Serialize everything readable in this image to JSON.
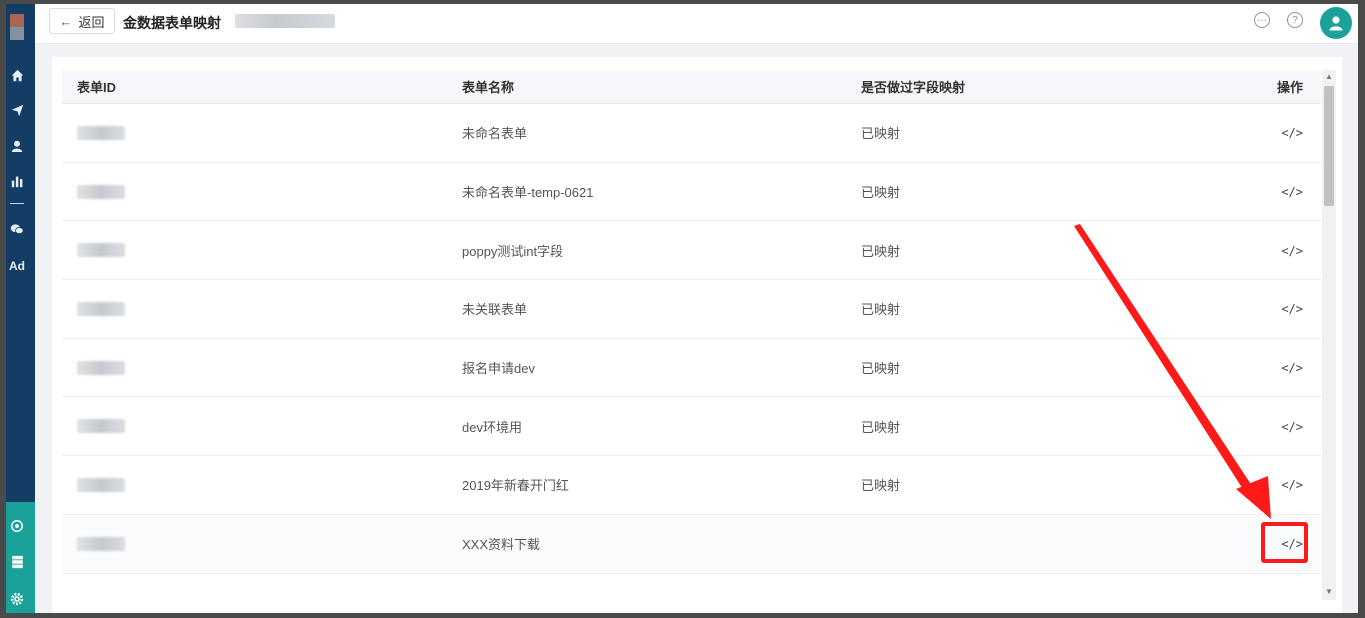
{
  "header": {
    "back_label": "返回",
    "title": "金数据表单映射"
  },
  "sidebar": {
    "items": [
      {
        "icon": "home-icon"
      },
      {
        "icon": "send-icon"
      },
      {
        "icon": "user-icon"
      },
      {
        "icon": "chart-icon"
      },
      {
        "icon": "wechat-icon"
      },
      {
        "icon": "ad-icon",
        "label": "Ad"
      }
    ],
    "bottom_items": [
      {
        "icon": "network-icon"
      },
      {
        "icon": "server-icon"
      },
      {
        "icon": "gear-icon"
      }
    ]
  },
  "table": {
    "headers": {
      "id": "表单ID",
      "name": "表单名称",
      "mapped": "是否做过字段映射",
      "action": "操作"
    },
    "rows": [
      {
        "name": "未命名表单",
        "mapped": "已映射",
        "action_icon": "</>"
      },
      {
        "name": "未命名表单-temp-0621",
        "mapped": "已映射",
        "action_icon": "</>"
      },
      {
        "name": "poppy测试int字段",
        "mapped": "已映射",
        "action_icon": "</>"
      },
      {
        "name": "未关联表单",
        "mapped": "已映射",
        "action_icon": "</>"
      },
      {
        "name": "报名申请dev",
        "mapped": "已映射",
        "action_icon": "</>"
      },
      {
        "name": "dev环境用",
        "mapped": "已映射",
        "action_icon": "</>"
      },
      {
        "name": "2019年新春开门红",
        "mapped": "已映射",
        "action_icon": "</>"
      },
      {
        "name": "XXX资料下载",
        "mapped": "",
        "action_icon": "</>"
      }
    ]
  },
  "colors": {
    "sidebar": "#133d64",
    "accent": "#1aa19a",
    "annotation": "#ff1a1a"
  }
}
